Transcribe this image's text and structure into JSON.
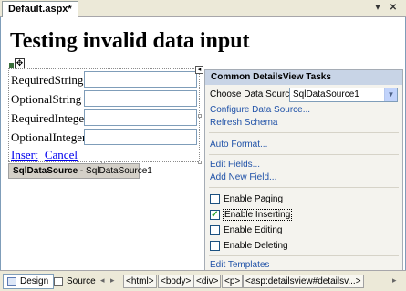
{
  "document_tab": "Default.aspx*",
  "heading": "Testing invalid data input",
  "form": {
    "fields": [
      {
        "label": "RequiredString",
        "value": ""
      },
      {
        "label": "OptionalString",
        "value": ""
      },
      {
        "label": "RequiredInteger",
        "value": ""
      },
      {
        "label": "OptionalInteger",
        "value": ""
      }
    ],
    "insert_link": "Insert",
    "cancel_link": "Cancel"
  },
  "datasource_control": {
    "type": "SqlDataSource",
    "separator": " - ",
    "id": "SqlDataSource1"
  },
  "tasks_panel": {
    "title": "Common DetailsView Tasks",
    "choose_label": "Choose Data Source:",
    "choose_value": "SqlDataSource1",
    "links_1": [
      "Configure Data Source...",
      "Refresh Schema"
    ],
    "auto_format": "Auto Format...",
    "links_2": [
      "Edit Fields...",
      "Add New Field..."
    ],
    "options": [
      {
        "label": "Enable Paging",
        "checked": false
      },
      {
        "label": "Enable Inserting",
        "checked": true
      },
      {
        "label": "Enable Editing",
        "checked": false
      },
      {
        "label": "Enable Deleting",
        "checked": false
      }
    ],
    "edit_templates": "Edit Templates"
  },
  "bottom": {
    "design_label": "Design",
    "source_label": "Source",
    "breadcrumbs": [
      "<html>",
      "<body>",
      "<div>",
      "<p>",
      "<asp:detailsview#detailsv...>"
    ]
  },
  "icons": {
    "dropdown": "chevron-down-icon",
    "check": "checkmark-icon",
    "move": "move-handle-icon"
  }
}
